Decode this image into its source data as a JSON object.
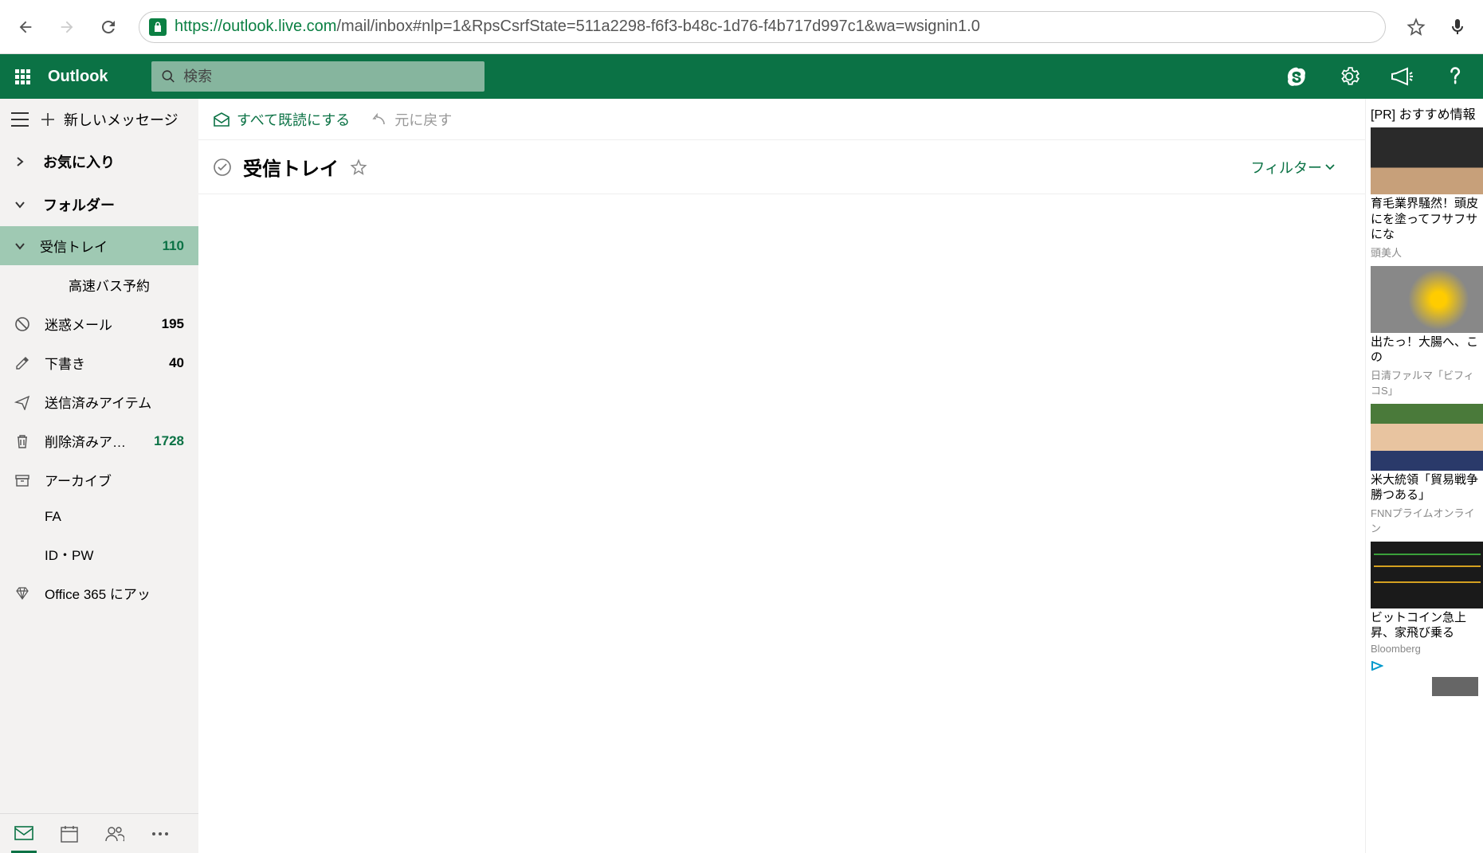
{
  "browser": {
    "url_secure": "https://",
    "url_host": "outlook.live.com",
    "url_path": "/mail/inbox#nlp=1&RpsCsrfState=511a2298-f6f3-b48c-1d76-f4b717d997c1&wa=wsignin1.0"
  },
  "header": {
    "app_title": "Outlook",
    "search_placeholder": "検索"
  },
  "commands": {
    "new_message": "新しいメッセージ",
    "mark_all_read": "すべて既読にする",
    "undo": "元に戻す"
  },
  "sidebar": {
    "favorites": "お気に入り",
    "folders": "フォルダー",
    "items": [
      {
        "label": "受信トレイ",
        "count": "110"
      },
      {
        "label": "高速バス予約"
      },
      {
        "label": "迷惑メール",
        "count": "195"
      },
      {
        "label": "下書き",
        "count": "40"
      },
      {
        "label": "送信済みアイテム"
      },
      {
        "label": "削除済みア…",
        "count": "1728"
      },
      {
        "label": "アーカイブ"
      },
      {
        "label": "FA"
      },
      {
        "label": "ID・PW"
      },
      {
        "label": "Office 365 にアッ"
      }
    ]
  },
  "content": {
    "title": "受信トレイ",
    "filter": "フィルター"
  },
  "ads": {
    "header": "[PR] おすすめ情報",
    "items": [
      {
        "title": "育毛業界騒然！頭皮にを塗ってフサフサにな",
        "source": "頭美人"
      },
      {
        "title": "出たっ！大腸へ、この",
        "source": "日清ファルマ「ビフィコS」"
      },
      {
        "title": "米大統領「貿易戦争勝つある」",
        "source": "FNNプライムオンライン"
      },
      {
        "title": "ビットコイン急上昇、家飛び乗る",
        "source": "Bloomberg"
      }
    ]
  }
}
